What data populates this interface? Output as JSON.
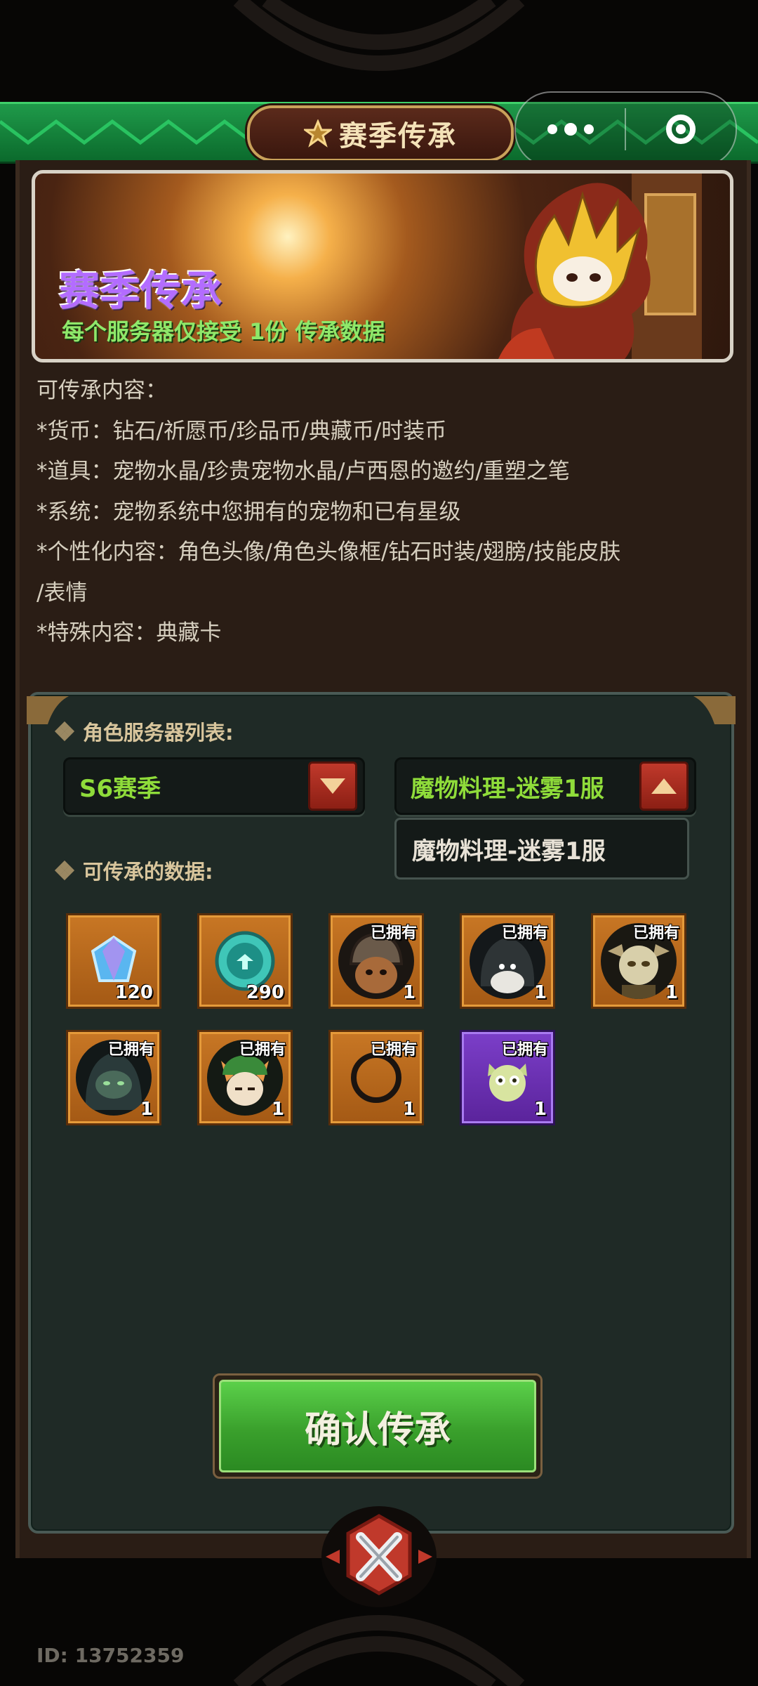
{
  "header": {
    "title": "赛季传承",
    "more_icon": "more-dots-icon",
    "close_icon": "miniprogram-close-icon"
  },
  "banner": {
    "title": "赛季传承",
    "subtitle": "每个服务器仅接受 1份 传承数据"
  },
  "description": {
    "lines": [
      "可传承内容：",
      "*货币：钻石/祈愿币/珍品币/典藏币/时装币",
      "*道具：宠物水晶/珍贵宠物水晶/卢西恩的邀约/重塑之笔",
      "*系统：宠物系统中您拥有的宠物和已有星级",
      "*个性化内容：角色头像/角色头像框/钻石时装/翅膀/技能皮肤",
      "/表情",
      "*特殊内容：典藏卡"
    ]
  },
  "panel": {
    "server_list_label": "角色服务器列表:",
    "season_select": "S6赛季",
    "server_select": "魔物料理-迷雾1服",
    "dropdown_option": "魔物料理-迷雾1服",
    "data_label": "可传承的数据:"
  },
  "items": [
    {
      "name": "diamond-gem",
      "qty": "120",
      "owned": "",
      "style": "orange"
    },
    {
      "name": "teal-coin",
      "qty": "290",
      "owned": "",
      "style": "orange"
    },
    {
      "name": "pet-helmet-rat",
      "qty": "1",
      "owned": "已拥有",
      "style": "orange"
    },
    {
      "name": "pet-hooded-sheep",
      "qty": "1",
      "owned": "已拥有",
      "style": "orange"
    },
    {
      "name": "pet-horned-skull",
      "qty": "1",
      "owned": "已拥有",
      "style": "orange"
    },
    {
      "name": "pet-dark-hood",
      "qty": "1",
      "owned": "已拥有",
      "style": "orange"
    },
    {
      "name": "pet-fox-archer",
      "qty": "1",
      "owned": "已拥有",
      "style": "orange"
    },
    {
      "name": "avatar-frame-ring",
      "qty": "1",
      "owned": "已拥有",
      "style": "orange"
    },
    {
      "name": "pet-green-owl",
      "qty": "1",
      "owned": "已拥有",
      "style": "purple"
    }
  ],
  "confirm_label": "确认传承",
  "footer": {
    "id_text": "ID: 13752359"
  },
  "colors": {
    "title_bar": "#0b6a2c",
    "panel": "#1f2a26",
    "accent_green": "#8fdc3a",
    "item_orange": "#c77624",
    "item_purple": "#7b3ec8"
  }
}
